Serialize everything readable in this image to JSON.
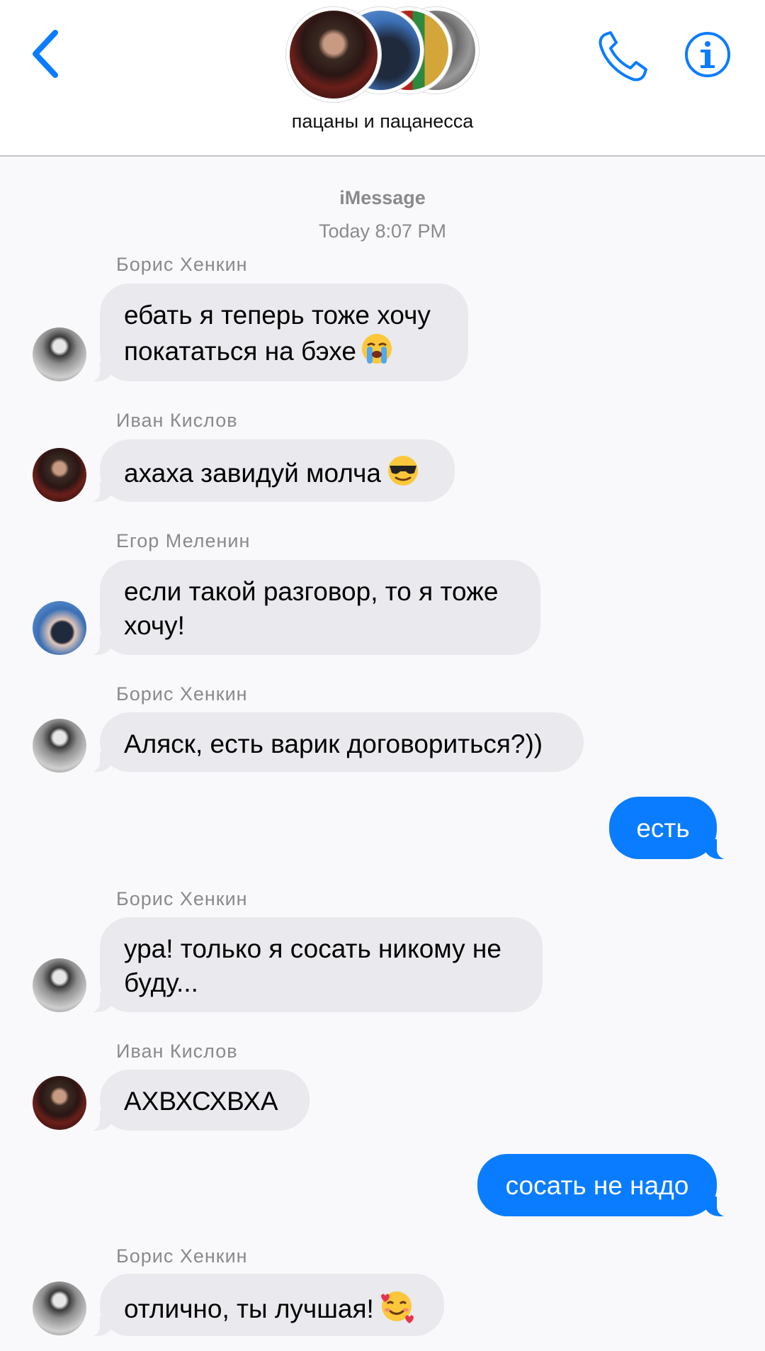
{
  "header": {
    "group_name": "пацаны и пацанесса",
    "back_icon": "chevron-left-icon",
    "call_icon": "phone-icon",
    "info_icon": "info-icon",
    "accent_color": "#0a7cff"
  },
  "thread": {
    "service": "iMessage",
    "timestamp": "Today 8:07 PM"
  },
  "messages": [
    {
      "sender": "Борис Хенкин",
      "line1": "ебать я теперь тоже хочу",
      "line2": "покататься на бэхе",
      "emoji": "loudly-crying-face-icon"
    },
    {
      "sender": "Иван Кислов",
      "line1": "ахаха завидуй молча",
      "emoji": "sunglasses-face-icon"
    },
    {
      "sender": "Егор Меленин",
      "line1": "если такой разговор, то я тоже",
      "line2": "хочу!"
    },
    {
      "sender": "Борис Хенкин",
      "line1": "Аляск, есть варик договориться?))"
    },
    {
      "outgoing": true,
      "line1": "есть"
    },
    {
      "sender": "Борис Хенкин",
      "line1": "ура! только я сосать никому не",
      "line2": "буду..."
    },
    {
      "sender": "Иван Кислов",
      "line1": "АХВХСХВХА"
    },
    {
      "outgoing": true,
      "line1": "сосать не надо"
    },
    {
      "sender": "Борис Хенкин",
      "line1": "отлично, ты лучшая!",
      "emoji": "smiling-face-with-hearts-icon"
    }
  ],
  "colors": {
    "incoming_bubble": "#e9e9ee",
    "outgoing_bubble": "#0a7cff",
    "meta_text": "#8a8a8e",
    "background": "#f9f9fb"
  }
}
